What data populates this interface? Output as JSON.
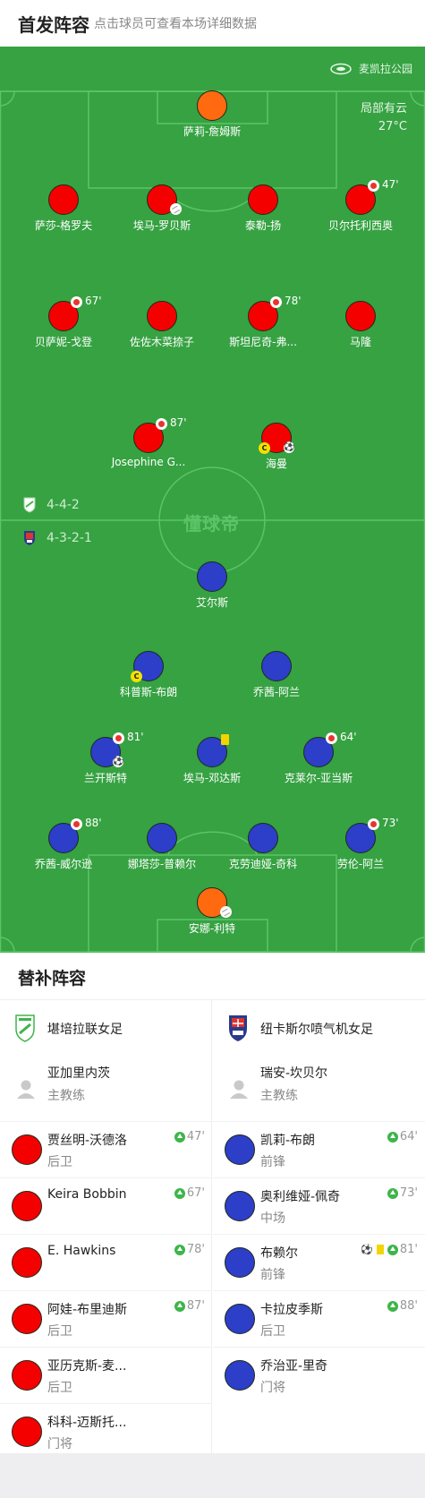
{
  "header": {
    "title": "首发阵容",
    "subtitle": "点击球员可查看本场详细数据"
  },
  "pitch": {
    "venue": "麦凯拉公园",
    "weather": "局部有云",
    "temperature": "27°C",
    "watermark": "懂球帝",
    "home_formation": "4-4-2",
    "away_formation": "4-3-2-1"
  },
  "home_players": [
    {
      "name": "萨莉-詹姆斯",
      "role": "goalkeeper"
    },
    {
      "name": "萨莎-格罗夫"
    },
    {
      "name": "埃马-罗贝斯"
    },
    {
      "name": "泰勒-扬"
    },
    {
      "name": "贝尔托利西奥",
      "sub_minute": "47'"
    },
    {
      "name": "贝萨妮-戈登",
      "sub_minute": "67'"
    },
    {
      "name": "佐佐木菜捺子"
    },
    {
      "name": "斯坦尼奇-弗...",
      "sub_minute": "78'"
    },
    {
      "name": "马隆"
    },
    {
      "name": "Josephine G...",
      "sub_minute": "87'"
    },
    {
      "name": "海曼",
      "captain": "C"
    }
  ],
  "away_players": [
    {
      "name": "艾尔斯"
    },
    {
      "name": "科普斯-布朗",
      "captain": "C"
    },
    {
      "name": "乔茜-阿兰"
    },
    {
      "name": "兰开斯特",
      "sub_minute": "81'"
    },
    {
      "name": "埃马-邓达斯"
    },
    {
      "name": "克莱尔-亚当斯",
      "sub_minute": "64'"
    },
    {
      "name": "乔茜-威尔逊",
      "sub_minute": "88'"
    },
    {
      "name": "娜塔莎-普赖尔"
    },
    {
      "name": "克劳迪娅-奇科"
    },
    {
      "name": "劳伦-阿兰",
      "sub_minute": "73'"
    },
    {
      "name": "安娜-利特",
      "role": "goalkeeper"
    }
  ],
  "substitutes": {
    "title": "替补阵容",
    "home": {
      "team": "堪培拉联女足",
      "coach": {
        "name": "亚加里内茨",
        "role": "主教练"
      },
      "players": [
        {
          "name": "贾丝明-沃德洛",
          "position": "后卫",
          "minute": "47'"
        },
        {
          "name": "Keira Bobbin",
          "position": "",
          "minute": "67'"
        },
        {
          "name": "E. Hawkins",
          "position": "",
          "minute": "78'"
        },
        {
          "name": "阿娃-布里迪斯",
          "position": "后卫",
          "minute": "87'"
        },
        {
          "name": "亚历克斯-麦...",
          "position": "后卫",
          "minute": ""
        },
        {
          "name": "科科-迈斯托...",
          "position": "门将",
          "minute": ""
        }
      ]
    },
    "away": {
      "team": "纽卡斯尔喷气机女足",
      "coach": {
        "name": "瑞安-坎贝尔",
        "role": "主教练"
      },
      "players": [
        {
          "name": "凯莉-布朗",
          "position": "前锋",
          "minute": "64'"
        },
        {
          "name": "奥利维娅-佩奇",
          "position": "中场",
          "minute": "73'"
        },
        {
          "name": "布赖尔",
          "position": "前锋",
          "minute": "81'"
        },
        {
          "name": "卡拉皮季斯",
          "position": "后卫",
          "minute": "88'"
        },
        {
          "name": "乔治亚-里奇",
          "position": "门将",
          "minute": ""
        }
      ]
    }
  },
  "colors": {
    "pitch": "#36a242",
    "home": "#f50000",
    "home_gk": "#ff6a10",
    "away": "#2d3ec8",
    "sub_arrow": "#3eb54a"
  },
  "icons": [
    "stadium-icon",
    "sub-out-icon",
    "captain-icon",
    "goal-ball-icon",
    "yellow-card-icon",
    "sub-in-arrow-icon",
    "coach-avatar-icon",
    "team-logo"
  ]
}
